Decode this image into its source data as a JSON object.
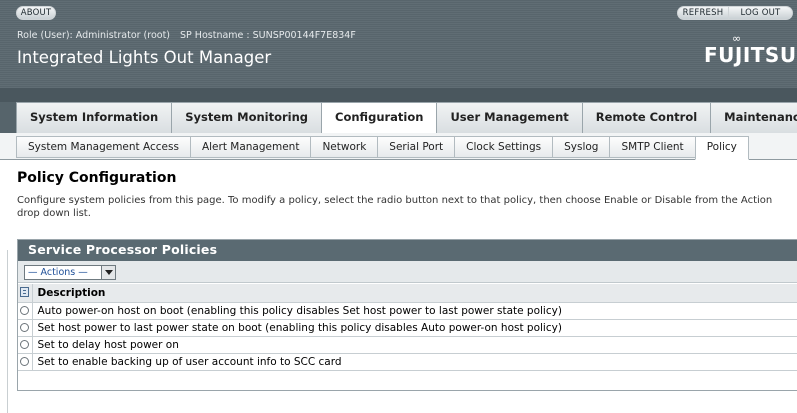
{
  "header": {
    "about_label": "ABOUT",
    "refresh_label": "REFRESH",
    "logout_label": "LOG OUT",
    "role_text": "Role (User): Administrator (root)",
    "hostname_text": "SP Hostname : SUNSP00144F7E834F",
    "product_name": "Integrated Lights Out Manager",
    "brand": "FUJITSU"
  },
  "primary_tabs": [
    {
      "label": "System Information",
      "active": false
    },
    {
      "label": "System Monitoring",
      "active": false
    },
    {
      "label": "Configuration",
      "active": true
    },
    {
      "label": "User Management",
      "active": false
    },
    {
      "label": "Remote Control",
      "active": false
    },
    {
      "label": "Maintenance",
      "active": false
    }
  ],
  "secondary_tabs": [
    {
      "label": "System Management Access",
      "active": false
    },
    {
      "label": "Alert Management",
      "active": false
    },
    {
      "label": "Network",
      "active": false
    },
    {
      "label": "Serial Port",
      "active": false
    },
    {
      "label": "Clock Settings",
      "active": false
    },
    {
      "label": "Syslog",
      "active": false
    },
    {
      "label": "SMTP Client",
      "active": false
    },
    {
      "label": "Policy",
      "active": true
    }
  ],
  "page": {
    "title": "Policy Configuration",
    "description": "Configure system policies from this page. To modify a policy, select the radio button next to that policy, then choose Enable or Disable from the Action drop down list."
  },
  "panel": {
    "title": "Service Processor Policies",
    "actions_label": "— Actions —",
    "column_description": "Description",
    "rows": [
      "Auto power-on host on boot (enabling this policy disables Set host power to last power state policy)",
      "Set host power to last power state on boot (enabling this policy disables Auto power-on host policy)",
      "Set to delay host power on",
      "Set to enable backing up of user account info to SCC card"
    ]
  },
  "colors": {
    "masthead": "#5b6870",
    "panel_header": "#5a6a72",
    "link_blue": "#1e4f98"
  }
}
